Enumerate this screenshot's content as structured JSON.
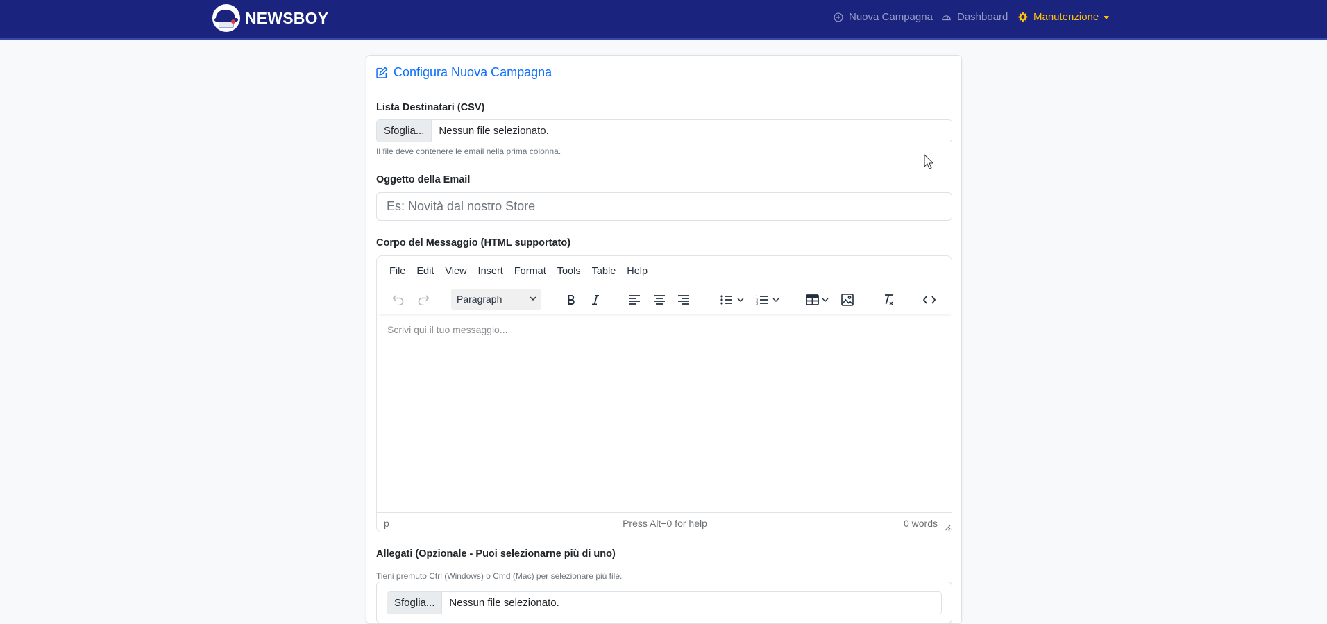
{
  "navbar": {
    "brand": "NEWSBOY",
    "items": [
      {
        "label": "Nuova Campagna",
        "icon": "plus-circle-icon"
      },
      {
        "label": "Dashboard",
        "icon": "speedometer-icon"
      },
      {
        "label": "Manutenzione",
        "icon": "gear-icon",
        "active": true,
        "dropdown": true
      }
    ]
  },
  "card": {
    "title": "Configura Nuova Campagna",
    "title_icon": "edit-icon"
  },
  "recipients": {
    "label": "Lista Destinatari (CSV)",
    "button": "Sfoglia...",
    "value": "Nessun file selezionato.",
    "help": "Il file deve contenere le email nella prima colonna."
  },
  "subject": {
    "label": "Oggetto della Email",
    "placeholder": "Es: Novità dal nostro Store",
    "value": ""
  },
  "body": {
    "label": "Corpo del Messaggio (HTML supportato)",
    "editor": {
      "menu": [
        "File",
        "Edit",
        "View",
        "Insert",
        "Format",
        "Tools",
        "Table",
        "Help"
      ],
      "block_format": "Paragraph",
      "placeholder": "Scrivi qui il tuo messaggio...",
      "status_path": "p",
      "status_help": "Press Alt+0 for help",
      "word_count": "0 words"
    }
  },
  "attachments": {
    "label": "Allegati (Opzionale - Puoi selezionarne più di uno)",
    "help": "Tieni premuto Ctrl (Windows) o Cmd (Mac) per selezionare più file.",
    "button": "Sfoglia...",
    "value": "Nessun file selezionato."
  },
  "colors": {
    "navbar_bg": "#1a237e",
    "accent": "#0d6efd",
    "active_nav": "#ffc107"
  }
}
